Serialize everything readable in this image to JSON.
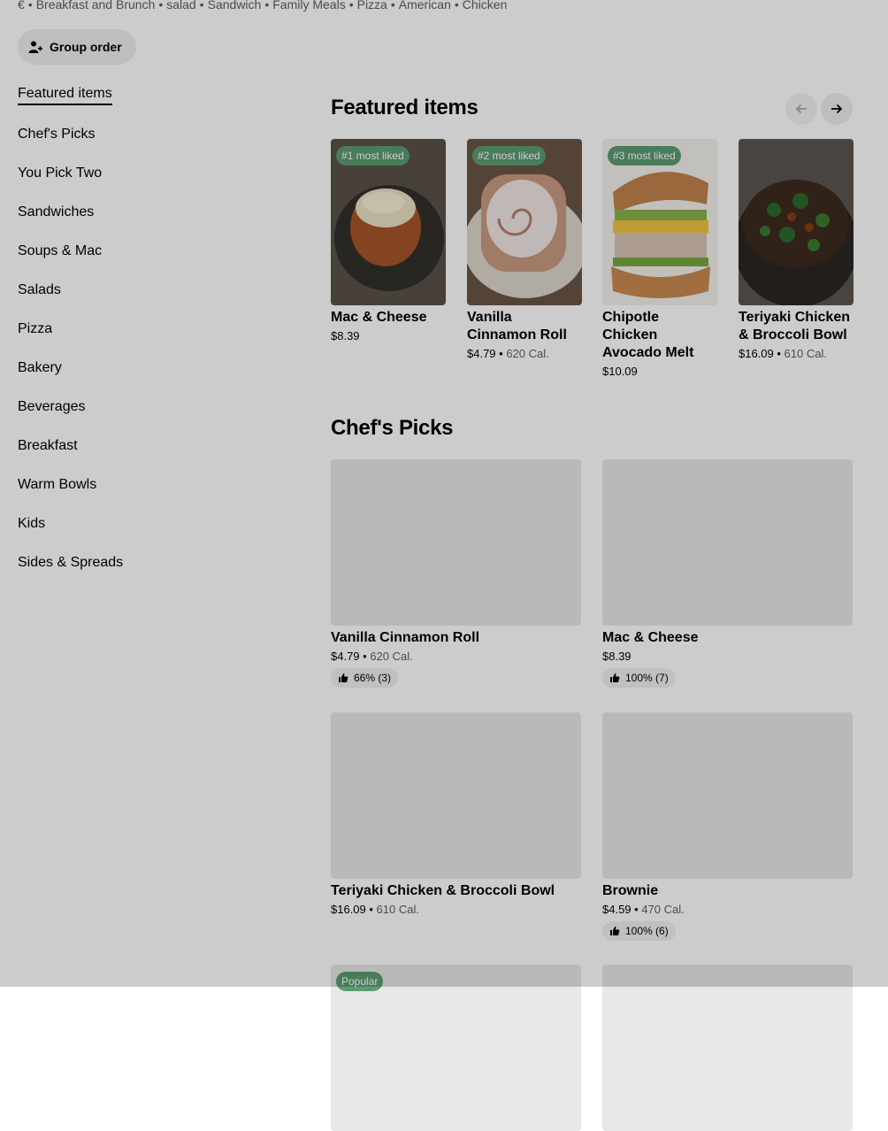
{
  "cuisines": [
    "€",
    "Breakfast and Brunch",
    "salad",
    "Sandwich",
    "Family Meals",
    "Pizza",
    "American",
    "Chicken"
  ],
  "group_order": {
    "label": "Group order",
    "icon": "person-add-icon"
  },
  "sidebar": {
    "items": [
      {
        "label": "Featured items",
        "active": true
      },
      {
        "label": "Chef's Picks"
      },
      {
        "label": "You Pick Two"
      },
      {
        "label": "Sandwiches"
      },
      {
        "label": "Soups & Mac"
      },
      {
        "label": "Salads"
      },
      {
        "label": "Pizza"
      },
      {
        "label": "Bakery"
      },
      {
        "label": "Beverages"
      },
      {
        "label": "Breakfast"
      },
      {
        "label": "Warm Bowls"
      },
      {
        "label": "Kids"
      },
      {
        "label": "Sides & Spreads"
      }
    ]
  },
  "featured": {
    "title": "Featured items",
    "prev_icon": "arrow-left-icon",
    "next_icon": "arrow-right-icon",
    "items": [
      {
        "badge": "#1 most liked",
        "name": "Mac & Cheese",
        "price": "$8.39",
        "cal": ""
      },
      {
        "badge": "#2 most liked",
        "name": "Vanilla Cinnamon Roll",
        "price": "$4.79",
        "cal": "620 Cal."
      },
      {
        "badge": "#3 most liked",
        "name": "Chipotle Chicken Avocado Melt",
        "price": "$10.09",
        "cal": ""
      },
      {
        "badge": "",
        "name": "Teriyaki Chicken & Broccoli Bowl",
        "price": "$16.09",
        "cal": "610 Cal."
      }
    ]
  },
  "chefs_picks": {
    "title": "Chef's Picks",
    "items": [
      {
        "name": "Vanilla Cinnamon Roll",
        "price": "$4.79",
        "cal": "620 Cal.",
        "rating": "66% (3)"
      },
      {
        "name": "Mac & Cheese",
        "price": "$8.39",
        "cal": "",
        "rating": "100% (7)"
      },
      {
        "name": "Teriyaki Chicken & Broccoli Bowl",
        "price": "$16.09",
        "cal": "610 Cal.",
        "rating": ""
      },
      {
        "name": "Brownie",
        "price": "$4.59",
        "cal": "470 Cal.",
        "rating": "100% (6)"
      },
      {
        "badge": "Popular"
      }
    ]
  },
  "colors": {
    "badge_green": "#5b9b72",
    "overlay": "rgba(0,0,0,0.2)"
  }
}
